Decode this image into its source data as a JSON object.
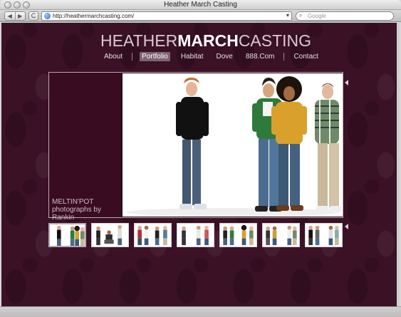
{
  "window": {
    "title": "Heather March Casting"
  },
  "toolbar": {
    "back_icon": "◀",
    "forward_icon": "▶",
    "reload_icon": "C",
    "url": "http://heathermarchcasting.com/",
    "search_placeholder": "Google"
  },
  "site": {
    "logo_part1": "HEATHER",
    "logo_part2": "MARCH",
    "logo_part3": "CASTING",
    "nav": [
      {
        "label": "About"
      },
      {
        "label": "Portfolio",
        "active": true
      },
      {
        "label": "Habitat"
      },
      {
        "label": "Dove"
      },
      {
        "label": "888.Com"
      },
      {
        "label": "Contact"
      }
    ],
    "caption_line1": "MELTIN'POT",
    "caption_line2": "photographs by Rankin"
  },
  "colors": {
    "background": "#3b1126",
    "accent": "#7d6572"
  },
  "thumbnails": [
    {
      "selected": true
    },
    {
      "selected": false
    },
    {
      "selected": false
    },
    {
      "selected": false
    },
    {
      "selected": false
    },
    {
      "selected": false
    },
    {
      "selected": false
    }
  ]
}
